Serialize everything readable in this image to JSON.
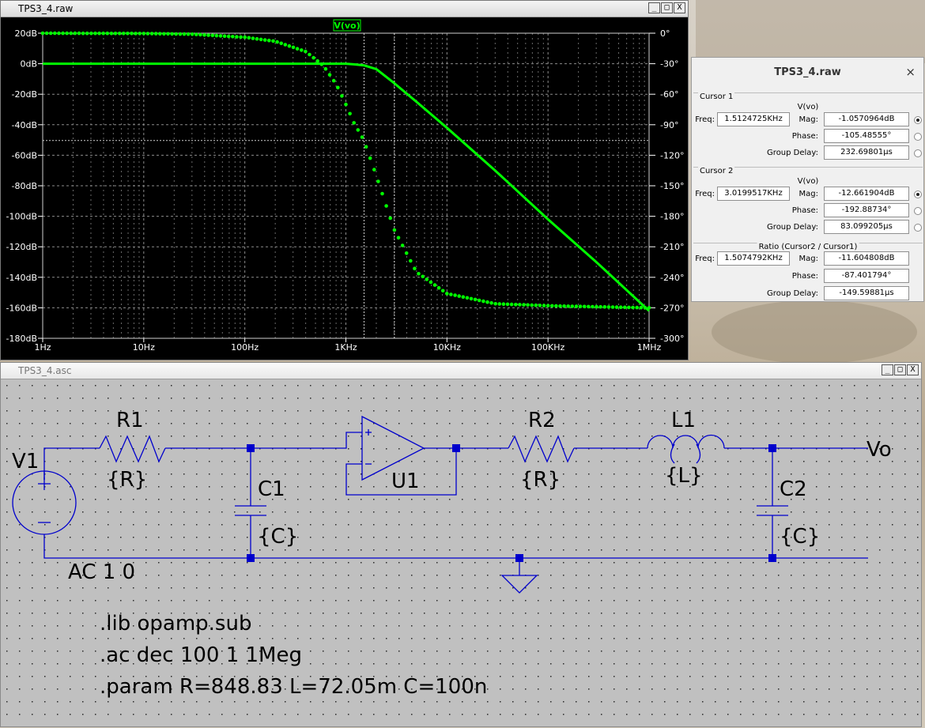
{
  "waveform_window": {
    "title": "TPS3_4.raw",
    "trace_label": "V(vo)",
    "trace_color": "#00ff00",
    "controls": {
      "minimize": "_",
      "maximize": "□",
      "close": "X"
    }
  },
  "chart_data": {
    "type": "line",
    "title": "V(vo)",
    "x_scale": "log",
    "xlim": [
      1,
      1000000
    ],
    "x_ticks": [
      "1Hz",
      "10Hz",
      "100Hz",
      "1KHz",
      "10KHz",
      "100KHz",
      "1MHz"
    ],
    "y_left_ticks": [
      "20dB",
      "0dB",
      "-20dB",
      "-40dB",
      "-60dB",
      "-80dB",
      "-100dB",
      "-120dB",
      "-140dB",
      "-160dB",
      "-180dB"
    ],
    "y_left_lim": [
      -180,
      20
    ],
    "y_right_ticks": [
      "0°",
      "-30°",
      "-60°",
      "-90°",
      "-120°",
      "-150°",
      "-180°",
      "-210°",
      "-240°",
      "-270°",
      "-300°"
    ],
    "y_right_lim": [
      -300,
      0
    ],
    "grid": true,
    "series": [
      {
        "name": "V(vo)",
        "kind": "magnitude",
        "style": "solid",
        "x": [
          1,
          10,
          100,
          500,
          1000,
          1200,
          1500,
          2000,
          3000,
          5000,
          10000,
          30000,
          100000,
          300000,
          1000000
        ],
        "y": [
          0,
          0,
          0,
          0,
          0,
          -0.4,
          -1.06,
          -3.5,
          -12.7,
          -25,
          -42,
          -70,
          -102,
          -130,
          -162
        ]
      },
      {
        "name": "V(vo)",
        "kind": "phase",
        "style": "dotted",
        "x": [
          1,
          10,
          30,
          100,
          200,
          400,
          600,
          800,
          1000,
          1200,
          1500,
          2000,
          3000,
          5000,
          10000,
          30000,
          100000,
          300000,
          1000000
        ],
        "y": [
          0,
          -0.3,
          -1,
          -4,
          -8,
          -18,
          -32,
          -50,
          -70,
          -88,
          -105,
          -140,
          -193,
          -235,
          -256,
          -266,
          -268,
          -269,
          -270
        ]
      }
    ],
    "cursors": [
      1512.4725,
      3019.9517
    ]
  },
  "cursor_dialog": {
    "title": "TPS3_4.raw",
    "close": "×",
    "cursor1": {
      "group": "Cursor 1",
      "signal": "V(vo)",
      "freq_label": "Freq:",
      "freq": "1.5124725KHz",
      "mag_label": "Mag:",
      "mag": "-1.0570964dB",
      "phase_label": "Phase:",
      "phase": "-105.48555°",
      "gd_label": "Group Delay:",
      "group_delay": "232.69801µs"
    },
    "cursor2": {
      "group": "Cursor 2",
      "signal": "V(vo)",
      "freq_label": "Freq:",
      "freq": "3.0199517KHz",
      "mag_label": "Mag:",
      "mag": "-12.661904dB",
      "phase_label": "Phase:",
      "phase": "-192.88734°",
      "gd_label": "Group Delay:",
      "group_delay": "83.099205µs"
    },
    "ratio": {
      "group": "Ratio (Cursor2 / Cursor1)",
      "freq_label": "Freq:",
      "freq": "1.5074792KHz",
      "mag_label": "Mag:",
      "mag": "-11.604808dB",
      "phase_label": "Phase:",
      "phase": "-87.401794°",
      "gd_label": "Group Delay:",
      "group_delay": "-149.59881µs"
    }
  },
  "schematic_window": {
    "title": "TPS3_4.asc",
    "controls": {
      "minimize": "_",
      "maximize": "□",
      "close": "X"
    },
    "wire_color": "#0000cc",
    "components": {
      "v1": {
        "name": "V1",
        "value": "AC 1 0"
      },
      "r1": {
        "name": "R1",
        "value": "{R}"
      },
      "c1": {
        "name": "C1",
        "value": "{C}"
      },
      "u1": {
        "name": "U1"
      },
      "r2": {
        "name": "R2",
        "value": "{R}"
      },
      "l1": {
        "name": "L1",
        "value": "{L}"
      },
      "c2": {
        "name": "C2",
        "value": "{C}"
      }
    },
    "net_label": "Vo",
    "directives": [
      ".lib opamp.sub",
      ".ac dec 100 1 1Meg",
      ".param R=848.83 L=72.05m C=100n"
    ]
  }
}
